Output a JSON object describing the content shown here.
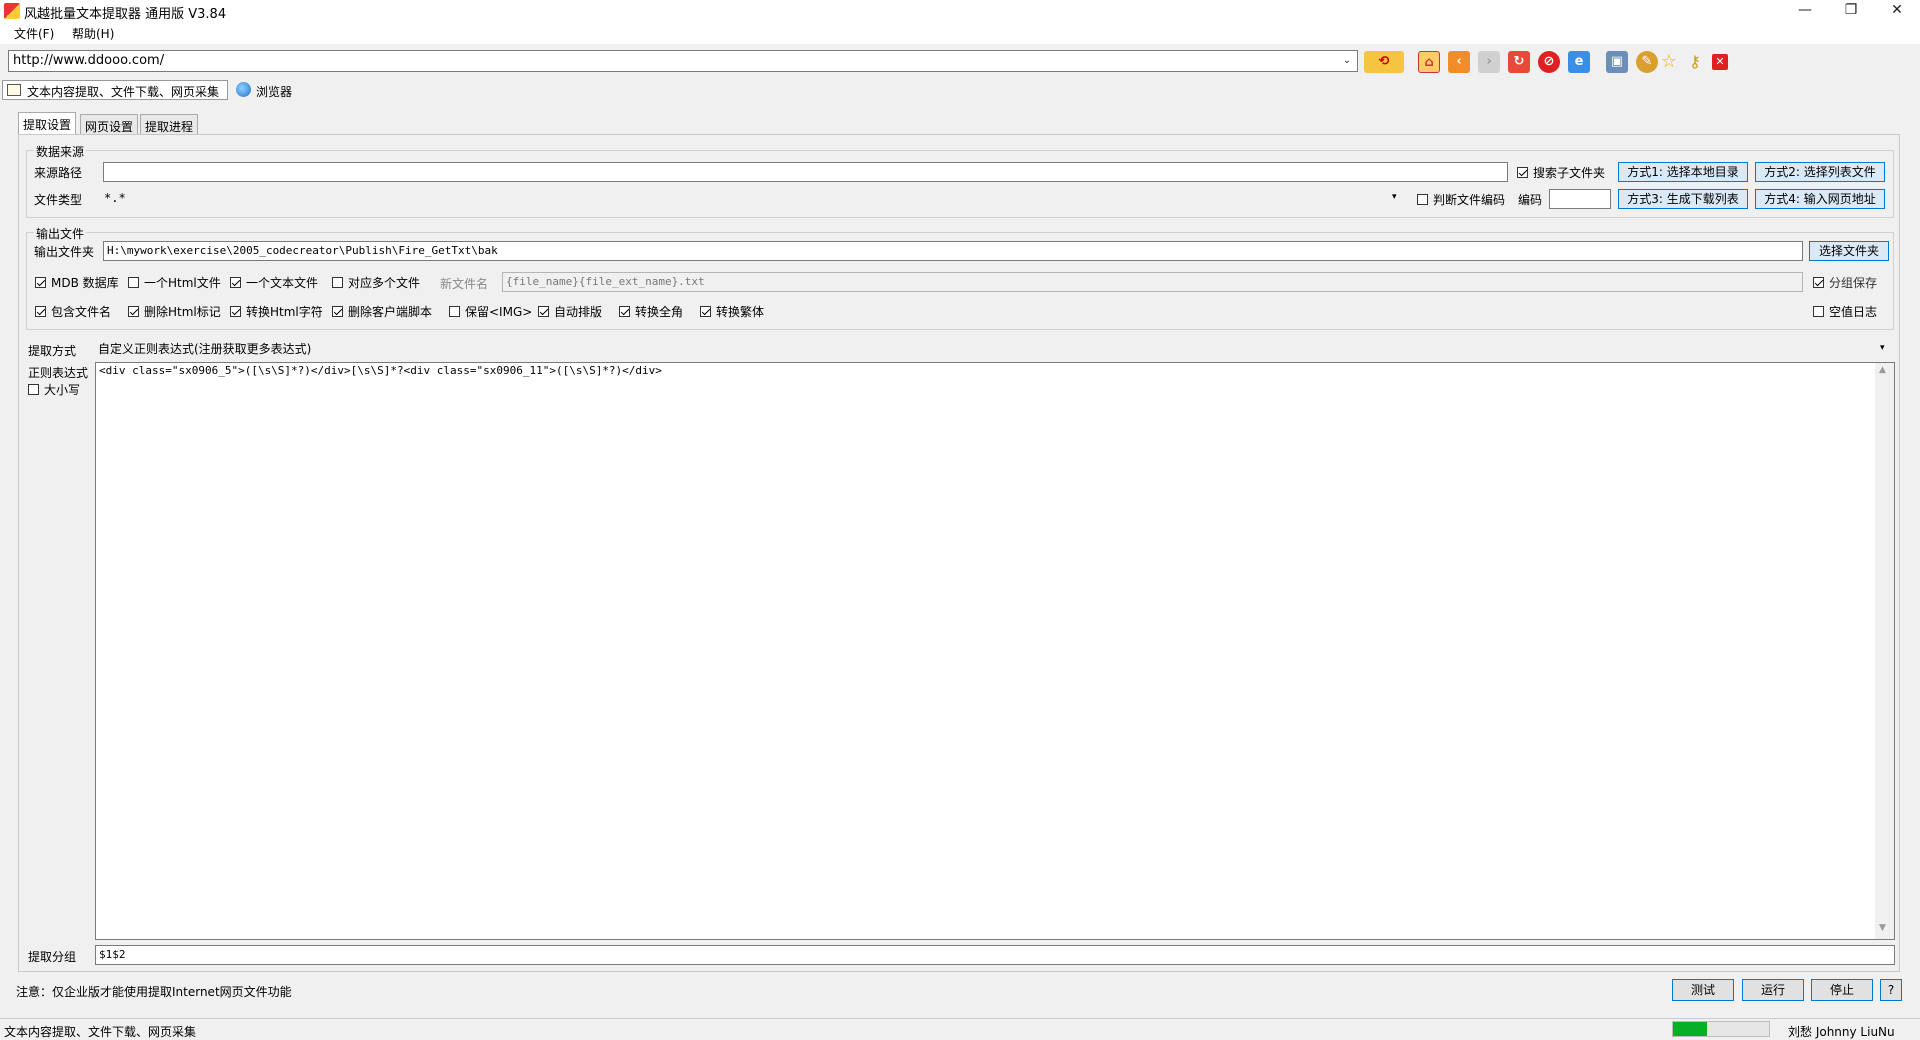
{
  "window": {
    "title": "风越批量文本提取器 通用版 V3.84",
    "minimize": "—",
    "maximize": "❐",
    "close": "✕"
  },
  "menu": [
    "文件(F)",
    "帮助(H)"
  ],
  "address": {
    "url": "http://www.ddooo.com/",
    "dropdown": "⌄"
  },
  "toolbar_icons": [
    "go-icon",
    "home-icon",
    "back-icon",
    "forward-icon",
    "refresh-icon",
    "stop-icon",
    "ie-icon",
    "window-icon",
    "tools-icon",
    "favorite-icon",
    "key-icon",
    "close-icon"
  ],
  "main_tabs": [
    "文本内容提取、文件下载、网页采集",
    "浏览器"
  ],
  "sub_tabs": [
    "提取设置",
    "网页设置",
    "提取进程"
  ],
  "data_source": {
    "group_label": "数据来源",
    "path_label": "来源路径",
    "path_value": "",
    "filetype_label": "文件类型",
    "filetype_value": "*.*",
    "search_sub": "搜索子文件夹",
    "detect_encoding": "判断文件编码",
    "encoding_label": "编码",
    "encoding_value": "",
    "btn_mode1": "方式1: 选择本地目录",
    "btn_mode2": "方式2: 选择列表文件",
    "btn_mode3": "方式3: 生成下载列表",
    "btn_mode4": "方式4: 输入网页地址"
  },
  "output": {
    "group_label": "输出文件",
    "folder_label": "输出文件夹",
    "folder_value": "H:\\mywork\\exercise\\2005_codecreator\\Publish\\Fire_GetTxt\\bak",
    "choose_folder": "选择文件夹",
    "mdb": "MDB 数据库",
    "one_html": "一个Html文件",
    "one_text": "一个文本文件",
    "multi_files": "对应多个文件",
    "newname_label": "新文件名",
    "newname_value": "{file_name}{file_ext_name}.txt",
    "group_save": "分组保存",
    "include_filename": "包含文件名",
    "remove_html": "删除Html标记",
    "convert_html": "转换Html字符",
    "remove_script": "删除客户端脚本",
    "keep_img": "保留<IMG>",
    "auto_format": "自动排版",
    "to_fullwidth": "转换全角",
    "to_traditional": "转换繁体",
    "empty_log": "空值日志"
  },
  "extract": {
    "mode_label": "提取方式",
    "mode_value": "自定义正则表达式(注册获取更多表达式)",
    "regex_label": "正则表达式",
    "case_label": "大小写",
    "regex_value": "<div class=\"sx0906_5\">([\\s\\S]*?)</div>[\\s\\S]*?<div class=\"sx0906_11\">([\\s\\S]*?)</div>",
    "group_label": "提取分组",
    "group_value": "$1$2"
  },
  "footer": {
    "note": "注意：仅企业版才能使用提取Internet网页文件功能",
    "test": "测试",
    "run": "运行",
    "stop": "停止",
    "help": "?"
  },
  "status": {
    "text": "文本内容提取、文件下载、网页采集",
    "progress": 0.35,
    "author": "刘愁 Johnny LiuNu"
  }
}
